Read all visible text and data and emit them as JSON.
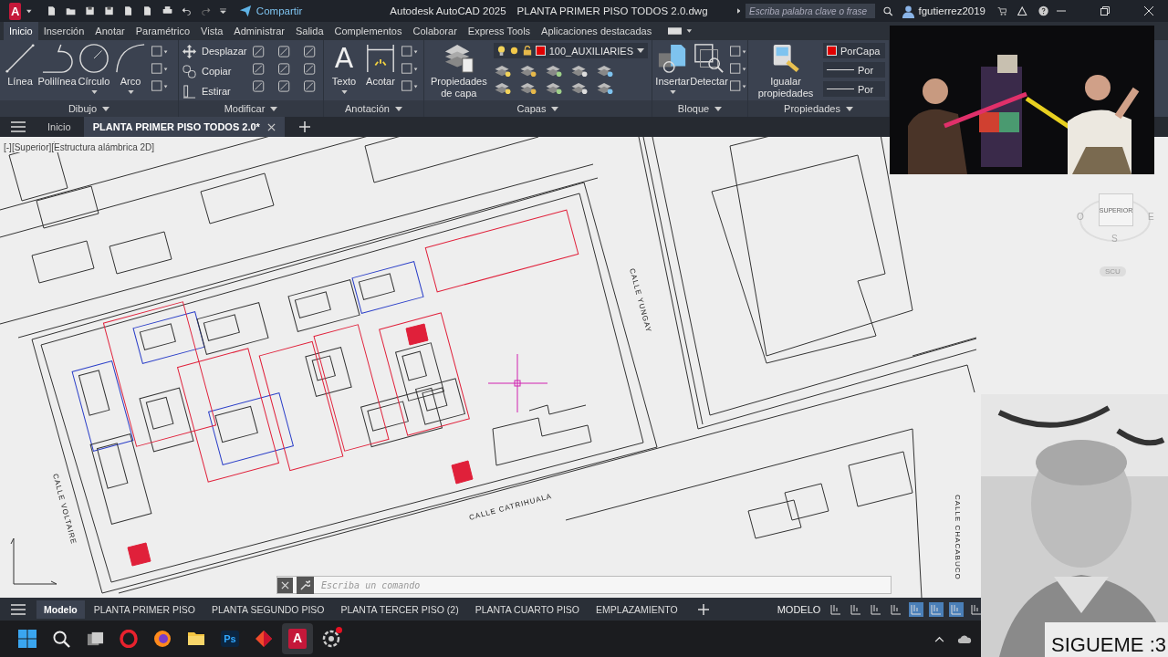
{
  "title_bar": {
    "app_letter": "A",
    "share_label": "Compartir",
    "app_title": "Autodesk AutoCAD 2025",
    "file_name": "PLANTA PRIMER PISO TODOS 2.0.dwg",
    "search": {
      "placeholder": "Escriba palabra clave o frase"
    },
    "user": "fgutierrez2019"
  },
  "ribbon_tabs": [
    {
      "label": "Inicio",
      "selected": true
    },
    {
      "label": "Inserción",
      "selected": false
    },
    {
      "label": "Anotar",
      "selected": false
    },
    {
      "label": "Paramétrico",
      "selected": false
    },
    {
      "label": "Vista",
      "selected": false
    },
    {
      "label": "Administrar",
      "selected": false
    },
    {
      "label": "Salida",
      "selected": false
    },
    {
      "label": "Complementos",
      "selected": false
    },
    {
      "label": "Colaborar",
      "selected": false
    },
    {
      "label": "Express Tools",
      "selected": false
    },
    {
      "label": "Aplicaciones destacadas",
      "selected": false
    }
  ],
  "ribbon_panels": [
    {
      "title": "Dibujo",
      "tools": [
        {
          "kind": "large",
          "label": "Línea",
          "dropdown": false
        },
        {
          "kind": "large",
          "label": "Polilínea",
          "dropdown": false
        },
        {
          "kind": "large",
          "label": "Círculo",
          "dropdown": true
        },
        {
          "kind": "large",
          "label": "Arco",
          "dropdown": true
        }
      ]
    },
    {
      "title": "Modificar",
      "tools": [
        {
          "kind": "small",
          "label": "Desplazar"
        },
        {
          "kind": "small",
          "label": "Copiar"
        },
        {
          "kind": "small",
          "label": "Estirar"
        }
      ]
    },
    {
      "title": "Anotación",
      "tools": [
        {
          "kind": "large",
          "label": "Texto",
          "glyph": "A",
          "dropdown": true
        },
        {
          "kind": "large",
          "label": "Acotar",
          "dropdown": false
        }
      ]
    },
    {
      "title": "Capas",
      "tools": [
        {
          "kind": "large",
          "label": "Propiedades de capa",
          "dropdown": false
        },
        {
          "kind": "layer_dropdown",
          "value": "100_AUXILIARIES",
          "color": "#e00000"
        }
      ]
    },
    {
      "title": "Bloque",
      "tools": [
        {
          "kind": "large",
          "label": "Insertar",
          "dropdown": true
        },
        {
          "kind": "large",
          "label": "Detectar",
          "dropdown": false
        }
      ]
    },
    {
      "title": "Propiedades",
      "tools": [
        {
          "kind": "large",
          "label": "Igualar propiedades",
          "dropdown": false
        },
        {
          "kind": "color_dropdown",
          "value": "PorCapa",
          "color": "#e00000"
        },
        {
          "kind": "line_dropdown",
          "value": "Por"
        },
        {
          "kind": "line_dropdown",
          "value": "Por"
        }
      ]
    }
  ],
  "document_tabs": [
    {
      "label": "Inicio",
      "selected": false,
      "closable": false
    },
    {
      "label": "PLANTA PRIMER PISO TODOS 2.0*",
      "selected": true,
      "closable": true
    }
  ],
  "viewport": {
    "label": "[-][Superior][Estructura alámbrica 2D]",
    "street_labels": [
      "CALLE YUNGAY",
      "CALLE VOLTAIRE",
      "CALLE CATRIHUALA",
      "CALLE CHACABUCO"
    ],
    "view_cube": {
      "face": "SUPERIOR",
      "west": "O",
      "east": "E",
      "south": "S",
      "ucs": "SCU"
    },
    "command_line": {
      "placeholder": "Escriba un comando"
    }
  },
  "layout_tabs": [
    {
      "label": "Modelo",
      "selected": true
    },
    {
      "label": "PLANTA PRIMER PISO",
      "selected": false
    },
    {
      "label": "PLANTA SEGUNDO PISO",
      "selected": false
    },
    {
      "label": "PLANTA TERCER PISO (2)",
      "selected": false
    },
    {
      "label": "PLANTA CUARTO PISO",
      "selected": false
    },
    {
      "label": "EMPLAZAMIENTO",
      "selected": false
    }
  ],
  "status_bar": {
    "mode": "MODELO"
  },
  "taskbar": {
    "apps": [
      {
        "kind": "start",
        "selected": false
      },
      {
        "kind": "search",
        "selected": false
      },
      {
        "kind": "task_view",
        "selected": false
      },
      {
        "kind": "opera",
        "selected": false
      },
      {
        "kind": "firefox",
        "selected": false
      },
      {
        "kind": "files",
        "selected": false
      },
      {
        "kind": "photoshop",
        "label": "Ps",
        "selected": false
      },
      {
        "kind": "diamond",
        "selected": false
      },
      {
        "kind": "autocad",
        "label": "A",
        "selected": true
      },
      {
        "kind": "browser",
        "selected": false,
        "notification": true
      }
    ]
  },
  "photo_caption": "SIGUEME :3"
}
